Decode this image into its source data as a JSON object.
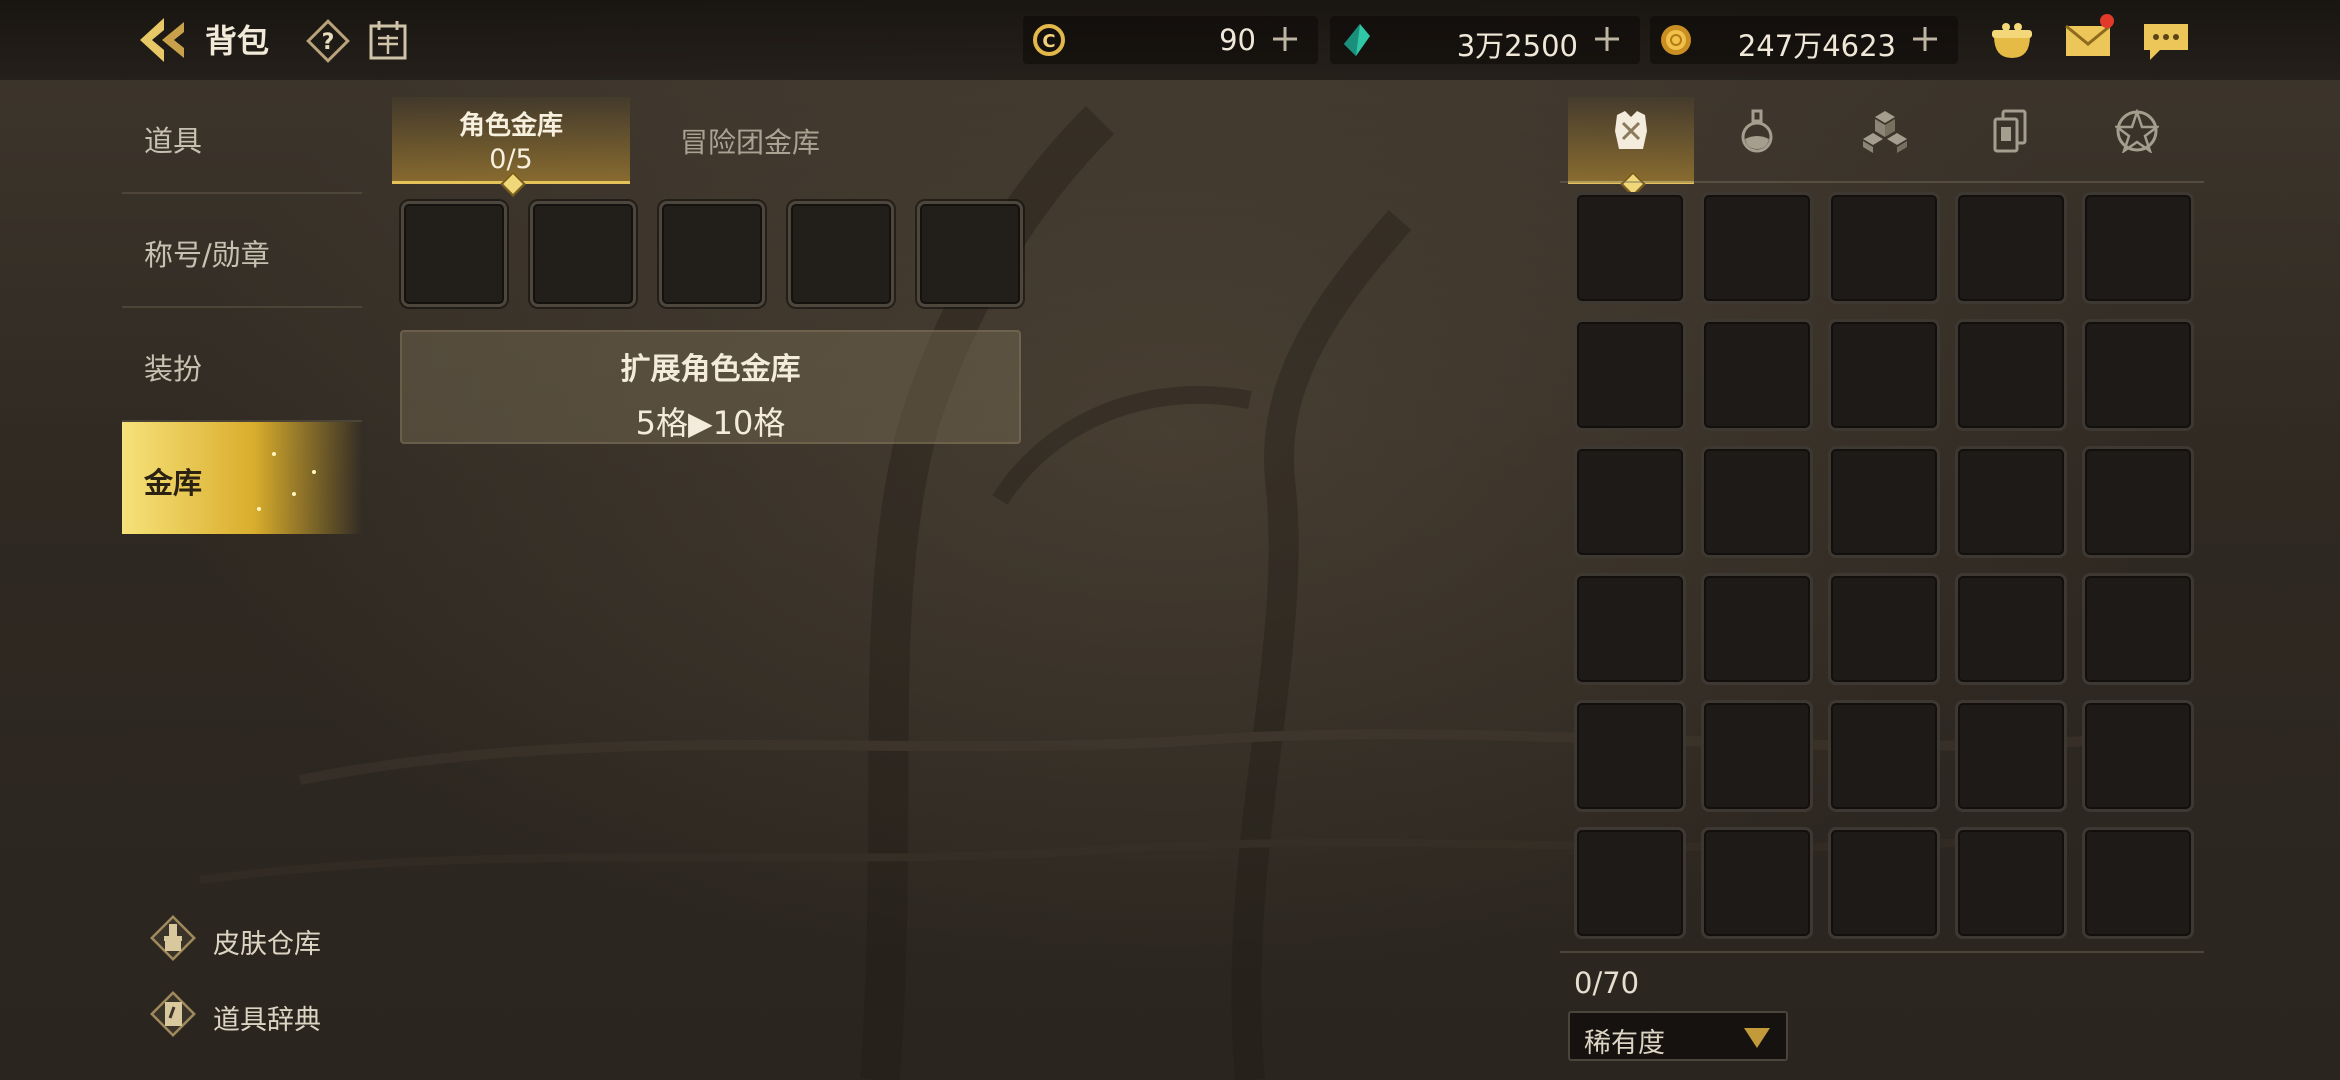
{
  "header": {
    "title": "背包",
    "currencies": [
      {
        "name": "stamina",
        "icon": "c-coin-icon",
        "value": "90"
      },
      {
        "name": "gem",
        "icon": "green-crystal-icon",
        "value": "3万2500"
      },
      {
        "name": "gold",
        "icon": "gold-coin-icon",
        "value": "247万4623"
      }
    ],
    "mail_has_notification": true
  },
  "sidebar": {
    "items": [
      {
        "label": "道具",
        "active": false
      },
      {
        "label": "称号/勋章",
        "active": false
      },
      {
        "label": "装扮",
        "active": false
      },
      {
        "label": "金库",
        "active": true
      }
    ],
    "links": [
      {
        "label": "皮肤仓库",
        "icon": "brush-icon"
      },
      {
        "label": "道具辞典",
        "icon": "book-icon"
      }
    ]
  },
  "vault": {
    "tabs": [
      {
        "label": "角色金库",
        "count": "0/5",
        "active": true
      },
      {
        "label": "冒险团金库",
        "active": false
      }
    ],
    "slots_visible": 5,
    "expand": {
      "line1": "扩展角色金库",
      "line2": "5格▶10格"
    }
  },
  "inventory": {
    "categories": [
      {
        "icon": "armor-icon",
        "active": true
      },
      {
        "icon": "potion-icon",
        "active": false
      },
      {
        "icon": "materials-cube-icon",
        "active": false
      },
      {
        "icon": "cards-icon",
        "active": false
      },
      {
        "icon": "pentagram-icon",
        "active": false
      }
    ],
    "rows": 6,
    "cols": 5,
    "count": "0/70",
    "sort": {
      "label": "稀有度"
    }
  },
  "colors": {
    "accent_gold": "#e6c35a",
    "notification_red": "#e23a2a"
  }
}
